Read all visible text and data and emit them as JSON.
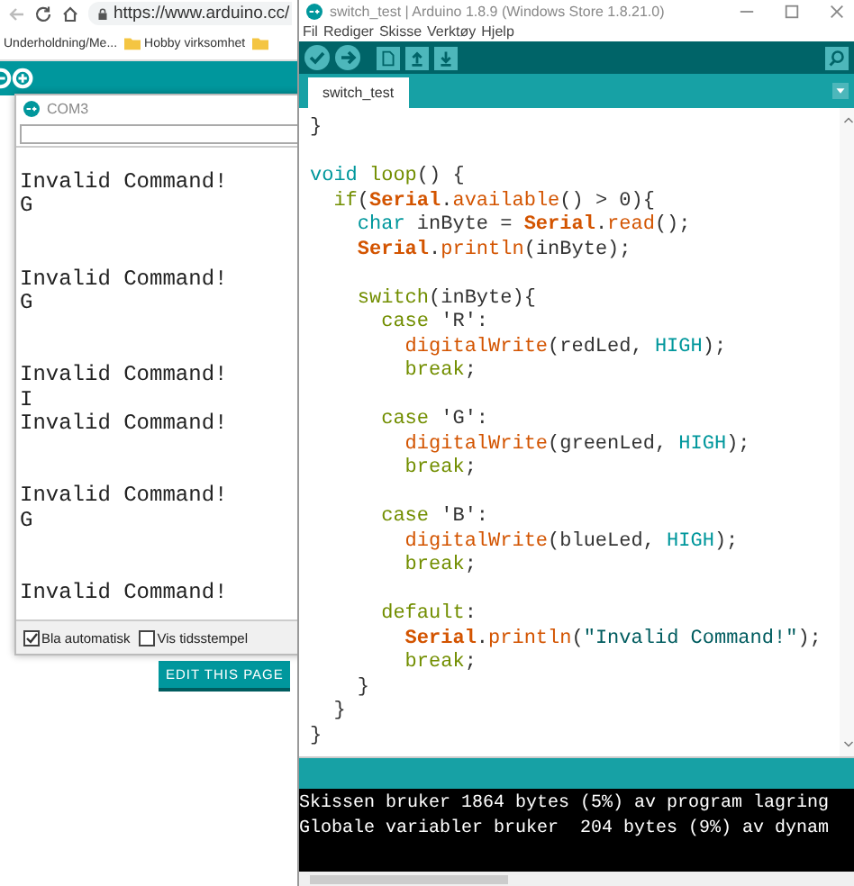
{
  "browser": {
    "url": "https://www.arduino.cc/",
    "bookmarks": [
      {
        "label": "Underholdning/Me...",
        "kind": "link"
      },
      {
        "label": "Hobby virksomhet",
        "kind": "folder"
      },
      {
        "kind": "folder"
      }
    ],
    "page_button": "EDIT THIS PAGE"
  },
  "serial_monitor": {
    "title": "COM3",
    "output": "Invalid Command!\nG\n\n\nInvalid Command!\nG\n\n\nInvalid Command!\nI\nInvalid Command!\n\n\nInvalid Command!\nG\n\n\nInvalid Command!",
    "options": [
      {
        "label": "Bla automatisk",
        "checked": true
      },
      {
        "label": "Vis tidsstempel",
        "checked": false
      }
    ]
  },
  "ide": {
    "title": "switch_test | Arduino 1.8.9 (Windows Store 1.8.21.0)",
    "menu": [
      "Fil",
      "Rediger",
      "Skisse",
      "Verktøy",
      "Hjelp"
    ],
    "tabs": [
      {
        "label": "switch_test",
        "selected": true
      }
    ],
    "code_blocks": [
      [
        [
          {
            "text": "}",
            "kind": "plain"
          }
        ]
      ],
      [
        [
          {
            "text": "void",
            "kind": "type"
          },
          {
            "text": " loop",
            "kind": "keyword"
          },
          {
            "text": "() {",
            "kind": "plain"
          }
        ],
        [
          {
            "text": "  if",
            "kind": "keyword"
          },
          {
            "text": "(",
            "kind": "plain"
          },
          {
            "text": "Serial",
            "kind": "object"
          },
          {
            "text": ".",
            "kind": "plain"
          },
          {
            "text": "available",
            "kind": "function"
          },
          {
            "text": "() > 0){",
            "kind": "plain"
          }
        ],
        [
          {
            "text": "    char",
            "kind": "type"
          },
          {
            "text": " inByte = ",
            "kind": "plain"
          },
          {
            "text": "Serial",
            "kind": "object"
          },
          {
            "text": ".",
            "kind": "plain"
          },
          {
            "text": "read",
            "kind": "function"
          },
          {
            "text": "();",
            "kind": "plain"
          }
        ],
        [
          {
            "text": "    Serial",
            "kind": "object"
          },
          {
            "text": ".",
            "kind": "plain"
          },
          {
            "text": "println",
            "kind": "function"
          },
          {
            "text": "(inByte);",
            "kind": "plain"
          }
        ]
      ],
      [
        [
          {
            "text": "    switch",
            "kind": "keyword"
          },
          {
            "text": "(inByte){",
            "kind": "plain"
          }
        ],
        [
          {
            "text": "      case",
            "kind": "keyword"
          },
          {
            "text": " 'R':",
            "kind": "plain"
          }
        ],
        [
          {
            "text": "        digitalWrite",
            "kind": "function"
          },
          {
            "text": "(redLed, ",
            "kind": "plain"
          },
          {
            "text": "HIGH",
            "kind": "type"
          },
          {
            "text": ");",
            "kind": "plain"
          }
        ],
        [
          {
            "text": "        break",
            "kind": "keyword"
          },
          {
            "text": ";",
            "kind": "plain"
          }
        ]
      ],
      [
        [
          {
            "text": "      case",
            "kind": "keyword"
          },
          {
            "text": " 'G':",
            "kind": "plain"
          }
        ],
        [
          {
            "text": "        digitalWrite",
            "kind": "function"
          },
          {
            "text": "(greenLed, ",
            "kind": "plain"
          },
          {
            "text": "HIGH",
            "kind": "type"
          },
          {
            "text": ");",
            "kind": "plain"
          }
        ],
        [
          {
            "text": "        break",
            "kind": "keyword"
          },
          {
            "text": ";",
            "kind": "plain"
          }
        ]
      ],
      [
        [
          {
            "text": "      case",
            "kind": "keyword"
          },
          {
            "text": " 'B':",
            "kind": "plain"
          }
        ],
        [
          {
            "text": "        digitalWrite",
            "kind": "function"
          },
          {
            "text": "(blueLed, ",
            "kind": "plain"
          },
          {
            "text": "HIGH",
            "kind": "type"
          },
          {
            "text": ");",
            "kind": "plain"
          }
        ],
        [
          {
            "text": "        break",
            "kind": "keyword"
          },
          {
            "text": ";",
            "kind": "plain"
          }
        ]
      ],
      [
        [
          {
            "text": "      default",
            "kind": "keyword"
          },
          {
            "text": ":",
            "kind": "plain"
          }
        ],
        [
          {
            "text": "        Serial",
            "kind": "object"
          },
          {
            "text": ".",
            "kind": "plain"
          },
          {
            "text": "println",
            "kind": "function"
          },
          {
            "text": "(",
            "kind": "plain"
          },
          {
            "text": "\"Invalid Command!\"",
            "kind": "string"
          },
          {
            "text": ");",
            "kind": "plain"
          }
        ],
        [
          {
            "text": "        break",
            "kind": "keyword"
          },
          {
            "text": ";",
            "kind": "plain"
          }
        ],
        [
          {
            "text": "    }",
            "kind": "plain"
          }
        ],
        [
          {
            "text": "  }",
            "kind": "plain"
          }
        ],
        [
          {
            "text": "}",
            "kind": "plain"
          }
        ]
      ]
    ],
    "console": [
      "Skissen bruker 1864 bytes (5%) av program lagring",
      "Globale variabler bruker  204 bytes (9%) av dynam"
    ]
  }
}
